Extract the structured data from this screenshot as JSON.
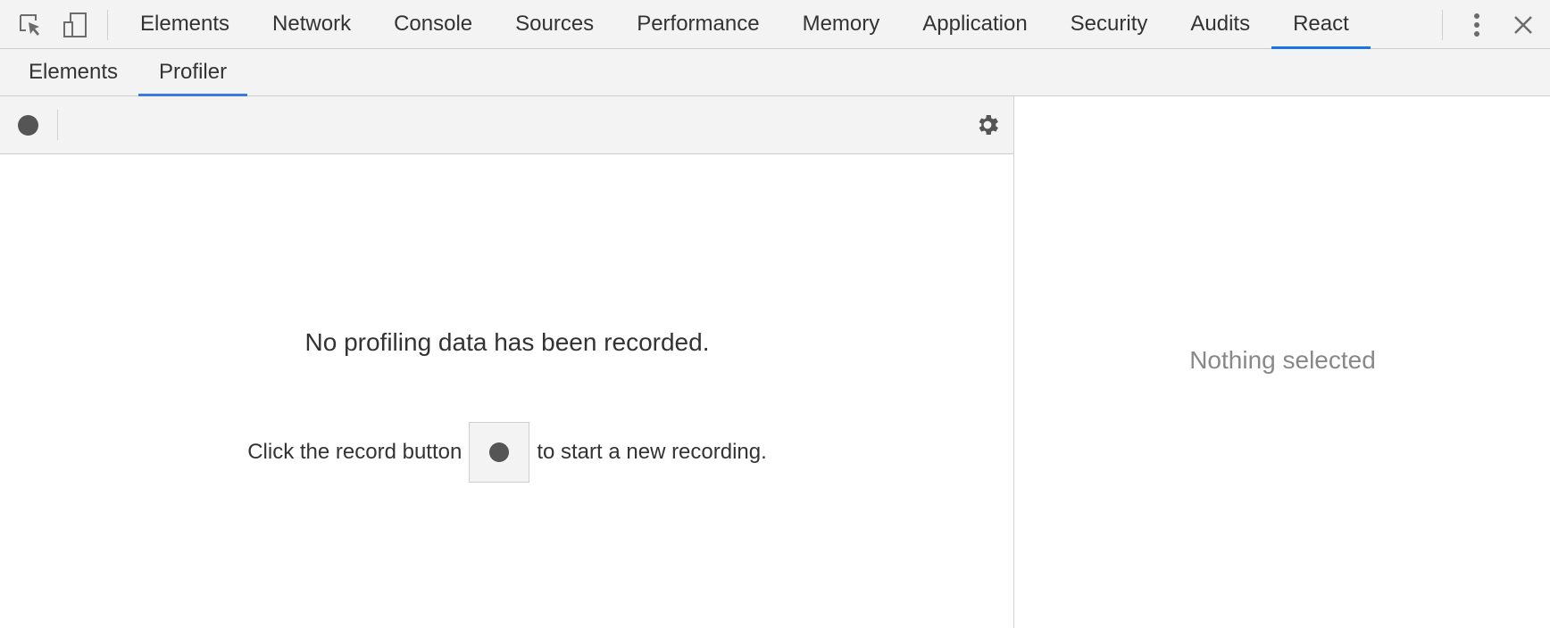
{
  "topbar": {
    "tabs": [
      {
        "label": "Elements"
      },
      {
        "label": "Network"
      },
      {
        "label": "Console"
      },
      {
        "label": "Sources"
      },
      {
        "label": "Performance"
      },
      {
        "label": "Memory"
      },
      {
        "label": "Application"
      },
      {
        "label": "Security"
      },
      {
        "label": "Audits"
      },
      {
        "label": "React",
        "active": true
      }
    ],
    "icons": [
      "inspect-element-icon",
      "device-toolbar-icon",
      "more-options-icon",
      "close-icon"
    ]
  },
  "subtabs": [
    {
      "label": "Elements"
    },
    {
      "label": "Profiler",
      "active": true
    }
  ],
  "profiler": {
    "empty_title": "No profiling data has been recorded.",
    "instruction_before": "Click the record button",
    "instruction_after": "to start a new recording."
  },
  "details": {
    "placeholder": "Nothing selected"
  },
  "colors": {
    "accent": "#1a73e8",
    "toolbar_bg": "#f3f3f3",
    "icon": "#555555"
  }
}
